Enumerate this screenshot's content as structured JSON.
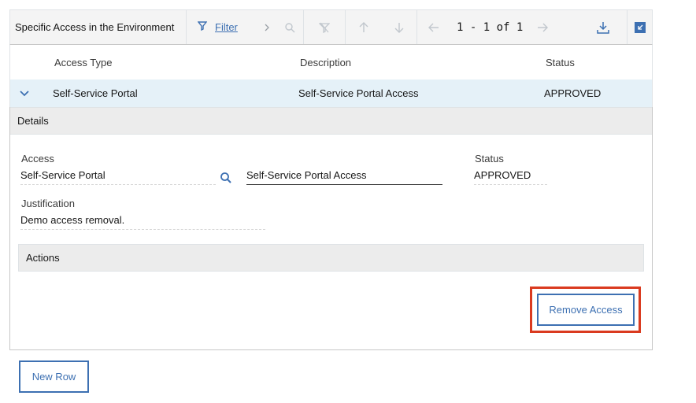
{
  "toolbar": {
    "title": "Specific Access in the Environment",
    "filter_label": "Filter",
    "pager_text": "1 - 1 of 1"
  },
  "grid": {
    "columns": [
      "Access Type",
      "Description",
      "Status"
    ],
    "rows": [
      {
        "access_type": "Self-Service Portal",
        "description": "Self-Service Portal Access",
        "status": "APPROVED"
      }
    ]
  },
  "details": {
    "section_title": "Details",
    "access_label": "Access",
    "access_value": "Self-Service Portal",
    "access_description": "Self-Service Portal Access",
    "status_label": "Status",
    "status_value": "APPROVED",
    "justification_label": "Justification",
    "justification_value": "Demo access removal.",
    "actions_title": "Actions",
    "remove_button": "Remove Access"
  },
  "footer": {
    "new_row_button": "New Row"
  },
  "colors": {
    "accent": "#3d70b2",
    "highlight": "#da3a1f",
    "row_selected": "#e5f1f8"
  }
}
